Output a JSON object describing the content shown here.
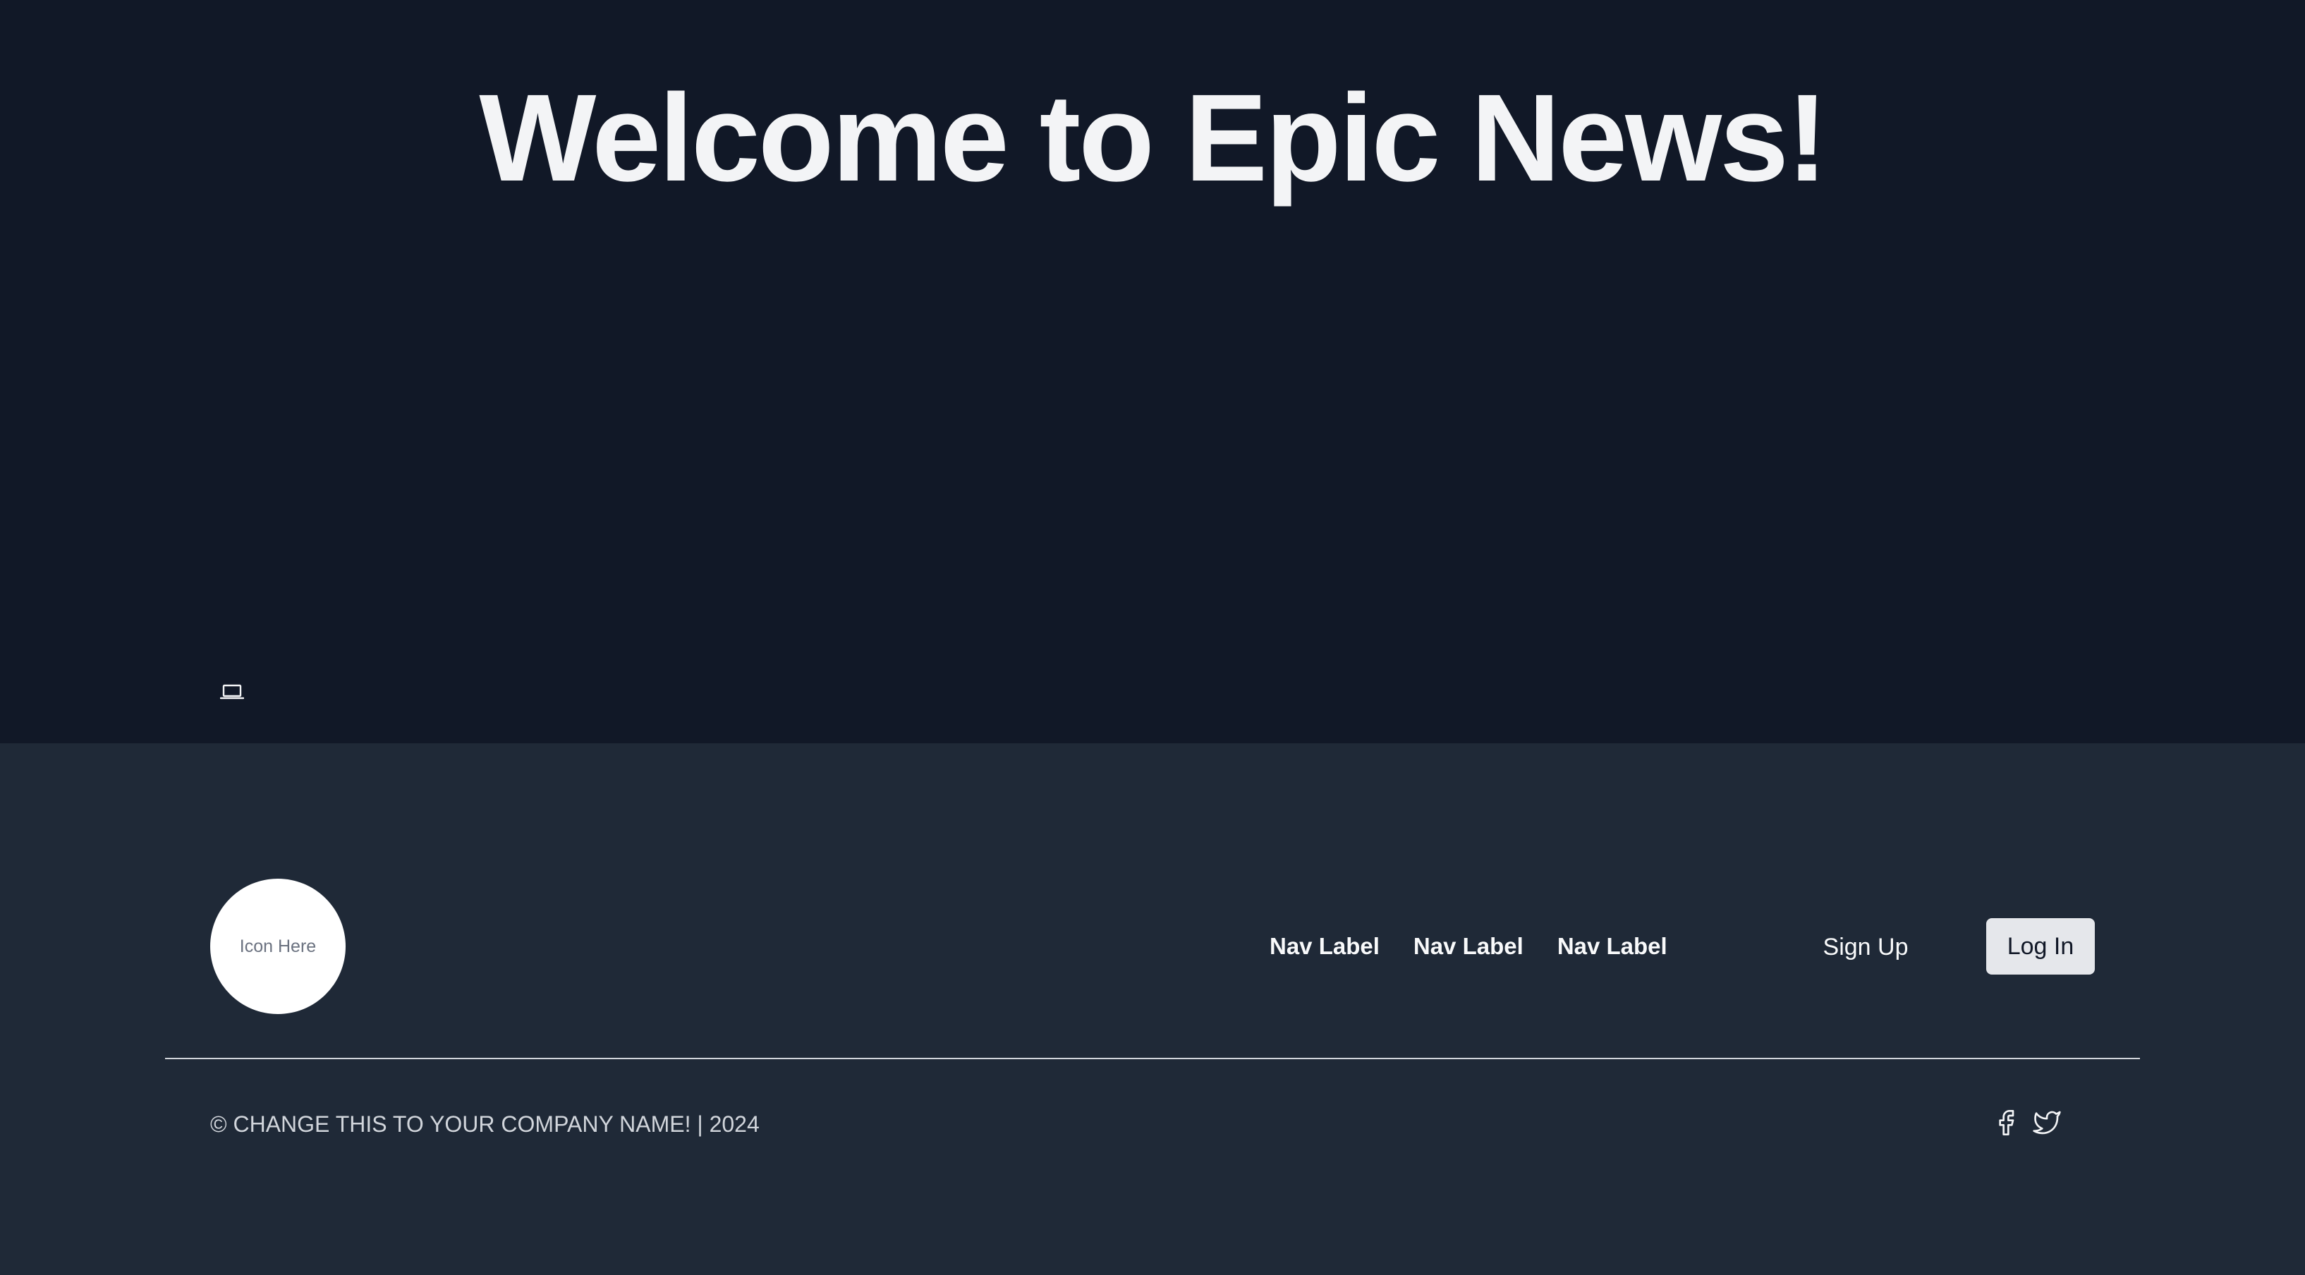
{
  "hero": {
    "title": "Welcome to Epic News!",
    "icon": "laptop-icon"
  },
  "footer": {
    "logo_placeholder": "Icon Here",
    "nav": [
      {
        "label": "Nav Label"
      },
      {
        "label": "Nav Label"
      },
      {
        "label": "Nav Label"
      }
    ],
    "signup_label": "Sign Up",
    "login_label": "Log In",
    "copyright": "© CHANGE THIS TO YOUR COMPANY NAME! | 2024",
    "social_icons": [
      "facebook-icon",
      "twitter-icon"
    ]
  },
  "colors": {
    "hero_background": "#111827",
    "footer_background": "#1f2937",
    "title_text": "#f3f4f6",
    "login_button_background": "#e5e7eb"
  }
}
